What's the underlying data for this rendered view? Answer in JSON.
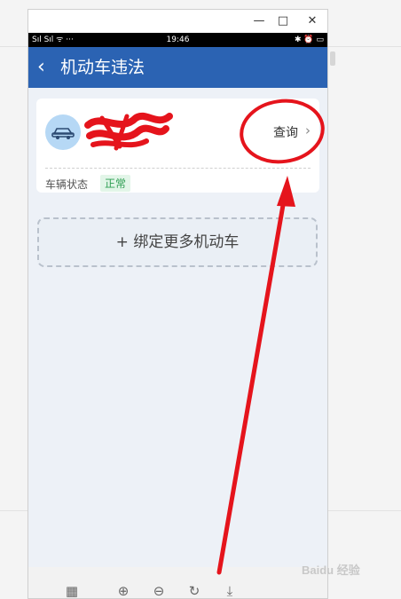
{
  "window": {
    "controls": [
      "—",
      "□",
      "✕"
    ]
  },
  "statusbar": {
    "left": "Sıl Sıl ᯤ ···",
    "time": "19:46",
    "right": "✱ ⏰ ▭"
  },
  "appbar": {
    "back": "‹",
    "title": "机动车违法"
  },
  "vehicle_card": {
    "plate": "",
    "query_label": "查询",
    "query_chevron": "›",
    "status_label": "车辆状态",
    "status_value": "正常"
  },
  "add_button": {
    "label": "+ 绑定更多机动车"
  },
  "toolbar": {
    "icons": [
      "grid-icon",
      "zoom-in-icon",
      "zoom-out-icon",
      "rotate-icon",
      "download-icon"
    ]
  },
  "watermark": {
    "text": "Baidu 经验"
  },
  "colors": {
    "appbar": "#2b63b3",
    "annotation": "#e5141c",
    "status_ok": "#2e9e52"
  }
}
